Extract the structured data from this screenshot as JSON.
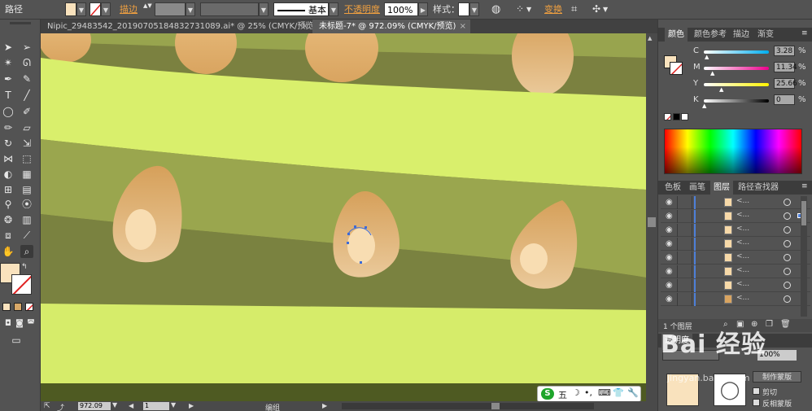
{
  "control_bar": {
    "mode_label": "路径",
    "stroke_label": "描边",
    "stroke_weight_arrow": "▲▼",
    "stroke_style_label": "基本",
    "opacity_label": "不透明度",
    "opacity_value": "100%",
    "style_label": "样式",
    "transform_label": "变换"
  },
  "tabs": [
    {
      "label": "Nipic_29483542_20190705184832731089.ai* @ 25% (CMYK/预览)",
      "close": "×"
    },
    {
      "label": "未标题-7* @ 972.09% (CMYK/预览)",
      "close": "×"
    }
  ],
  "color_panel": {
    "tabs": [
      "颜色",
      "颜色参考",
      "描边",
      "渐变"
    ],
    "channels": [
      {
        "label": "C",
        "value": "3.28",
        "unit": "%",
        "level": 0.033
      },
      {
        "label": "M",
        "value": "11.34",
        "unit": "%",
        "level": 0.113
      },
      {
        "label": "Y",
        "value": "25.66",
        "unit": "%",
        "level": 0.257
      },
      {
        "label": "K",
        "value": "0",
        "unit": "%",
        "level": 0.0
      }
    ],
    "fill_color": "#f9e2bd"
  },
  "layers_panel": {
    "tabs": [
      "色板",
      "画笔",
      "图层",
      "路径查找器"
    ],
    "row_label": "<...",
    "row_count": 8,
    "footer_label": "1 个图层"
  },
  "bottom_panel": {
    "tabs": [
      "透明度"
    ],
    "opacity_value": "100%",
    "make_mask_button": "制作蒙版",
    "clip_label": "剪切",
    "invert_mask_label": "反相蒙版"
  },
  "status_bar": {
    "zoom_value": "972.09",
    "page_value": "1",
    "mode_label": "编组"
  },
  "ime_toolbar": {
    "logo": "S",
    "mode_label": "五",
    "icons": [
      "moon-icon",
      "dot-icon",
      "keyboard-icon",
      "shirt-icon",
      "wrench-icon"
    ]
  },
  "watermark": {
    "text": "Bai 经验",
    "url": "jingyan.baidu.com"
  }
}
